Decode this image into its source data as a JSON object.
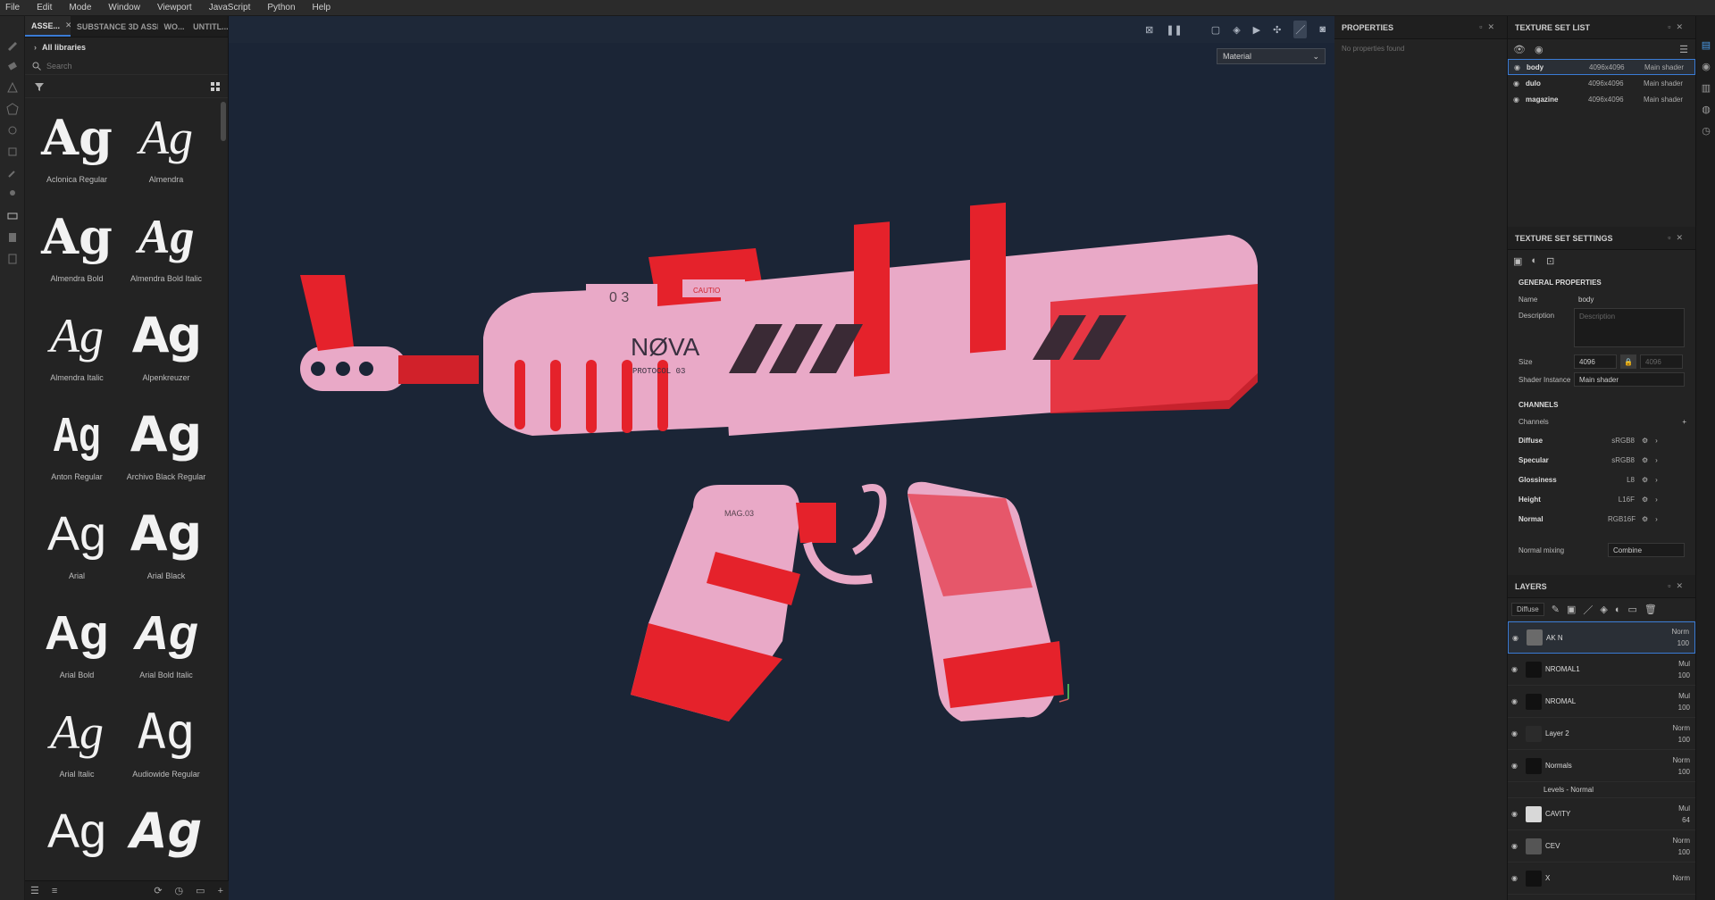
{
  "menu": [
    "File",
    "Edit",
    "Mode",
    "Window",
    "Viewport",
    "JavaScript",
    "Python",
    "Help"
  ],
  "assets": {
    "tabs": [
      {
        "label": "ASSE...",
        "close": "✕",
        "active": true
      },
      {
        "label": "SUBSTANCE 3D ASSE...",
        "active": false
      },
      {
        "label": "WO...",
        "active": false
      },
      {
        "label": "UNTITL...",
        "active": false
      }
    ],
    "library": "All libraries",
    "search_placeholder": "Search",
    "preview_glyph": "Ag",
    "fonts": [
      {
        "name": "Aclonica Regular"
      },
      {
        "name": "Almendra"
      },
      {
        "name": "Almendra Bold"
      },
      {
        "name": "Almendra Bold Italic"
      },
      {
        "name": "Almendra Italic"
      },
      {
        "name": "Alpenkreuzer"
      },
      {
        "name": "Anton Regular"
      },
      {
        "name": "Archivo Black Regular"
      },
      {
        "name": "Arial"
      },
      {
        "name": "Arial Black"
      },
      {
        "name": "Arial Bold"
      },
      {
        "name": "Arial Bold Italic"
      },
      {
        "name": "Arial Italic"
      },
      {
        "name": "Audiowide Regular"
      },
      {
        "name": ""
      },
      {
        "name": ""
      }
    ]
  },
  "viewport": {
    "mode_select": "Material",
    "model_text": {
      "brand": "NØVA",
      "protocol": "PROTOCOL 03",
      "mag": "MAG.03",
      "caution": "CAUTION",
      "serial": "0 3"
    }
  },
  "properties": {
    "title": "PROPERTIES",
    "empty": "No properties found"
  },
  "texture_set_list": {
    "title": "TEXTURE SET LIST",
    "items": [
      {
        "name": "body",
        "res": "4096x4096",
        "shader": "Main shader"
      },
      {
        "name": "dulo",
        "res": "4096x4096",
        "shader": "Main shader"
      },
      {
        "name": "magazine",
        "res": "4096x4096",
        "shader": "Main shader"
      }
    ]
  },
  "texture_set_settings": {
    "title": "TEXTURE SET SETTINGS",
    "general": "GENERAL PROPERTIES",
    "name_label": "Name",
    "name_value": "body",
    "desc_label": "Description",
    "desc_placeholder": "Description",
    "size_label": "Size",
    "size_value": "4096",
    "size_value2": "4096",
    "shader_label": "Shader Instance",
    "shader_value": "Main shader",
    "channels_title": "CHANNELS",
    "channels_label": "Channels",
    "channels": [
      {
        "name": "Diffuse",
        "format": "sRGB8"
      },
      {
        "name": "Specular",
        "format": "sRGB8"
      },
      {
        "name": "Glossiness",
        "format": "L8"
      },
      {
        "name": "Height",
        "format": "L16F"
      },
      {
        "name": "Normal",
        "format": "RGB16F"
      }
    ],
    "normal_mixing_label": "Normal mixing",
    "normal_mixing_value": "Combine"
  },
  "layers": {
    "title": "LAYERS",
    "channel": "Diffuse",
    "items": [
      {
        "name": "AK N",
        "blend": "Norm",
        "opacity": "100",
        "thumb": "#6a6a6a"
      },
      {
        "name": "NROMAL1",
        "blend": "Mul",
        "opacity": "100",
        "thumb": "#111111"
      },
      {
        "name": "NROMAL",
        "blend": "Mul",
        "opacity": "100",
        "thumb": "#111111"
      },
      {
        "name": "Layer 2",
        "blend": "Norm",
        "opacity": "100",
        "thumb": "#2b2b2b"
      },
      {
        "name": "Normals",
        "blend": "Norm",
        "opacity": "100",
        "thumb": "#111111"
      },
      {
        "name": "CAVITY",
        "blend": "Mul",
        "opacity": "64",
        "thumb": "#d8d8d8"
      },
      {
        "name": "CEV",
        "blend": "Norm",
        "opacity": "100",
        "thumb": "#555555"
      },
      {
        "name": "X",
        "blend": "Norm",
        "opacity": "",
        "thumb": "#111111"
      }
    ],
    "sub_effect": "Levels - Normal"
  },
  "colors": {
    "accent": "#3a7bd5",
    "viewport_bg": "#1b2536",
    "gun_pink": "#e9a9c7",
    "gun_red": "#e5222b"
  }
}
